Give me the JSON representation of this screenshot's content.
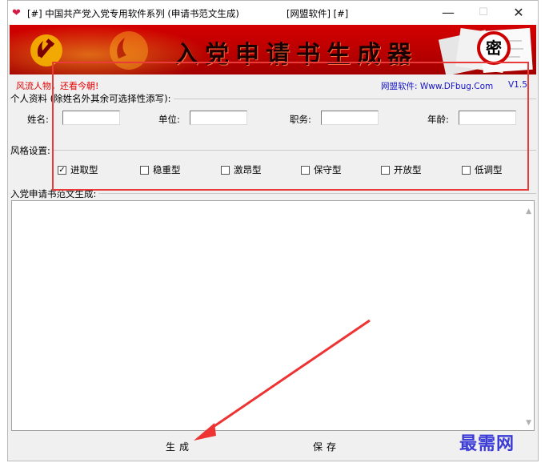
{
  "window": {
    "title_left": "[#] 中国共产党入党专用软件系列 (申请书范文生成)",
    "title_mid": "[网盟软件] [#]",
    "min_glyph": "—",
    "max_glyph": "☐",
    "close_glyph": "✕"
  },
  "banner": {
    "title": "入党申请书生成器",
    "seal": "密"
  },
  "header": {
    "notice": "风流人物，还看今朝!",
    "site": "网盟软件: Www.DFbug.Com",
    "version": "V1.5"
  },
  "personal": {
    "legend": "个人资料 (除姓名外其余可选择性添写):",
    "fields": [
      {
        "label": "姓名:",
        "value": ""
      },
      {
        "label": "单位:",
        "value": ""
      },
      {
        "label": "职务:",
        "value": ""
      },
      {
        "label": "年龄:",
        "value": ""
      }
    ]
  },
  "style": {
    "legend": "风格设置:",
    "options": [
      {
        "label": "进取型",
        "checked": true
      },
      {
        "label": "稳重型",
        "checked": false
      },
      {
        "label": "激昂型",
        "checked": false
      },
      {
        "label": "保守型",
        "checked": false
      },
      {
        "label": "开放型",
        "checked": false
      },
      {
        "label": "低调型",
        "checked": false
      }
    ]
  },
  "output": {
    "legend": "入党申请书范文生成:",
    "text": ""
  },
  "buttons": {
    "generate": "生成",
    "save": "保存"
  },
  "watermark": "最需网",
  "colors": {
    "banner_red": "#c80000",
    "highlight": "#ea3b3b",
    "link_blue": "#1515c8",
    "notice_red": "#e60000"
  }
}
